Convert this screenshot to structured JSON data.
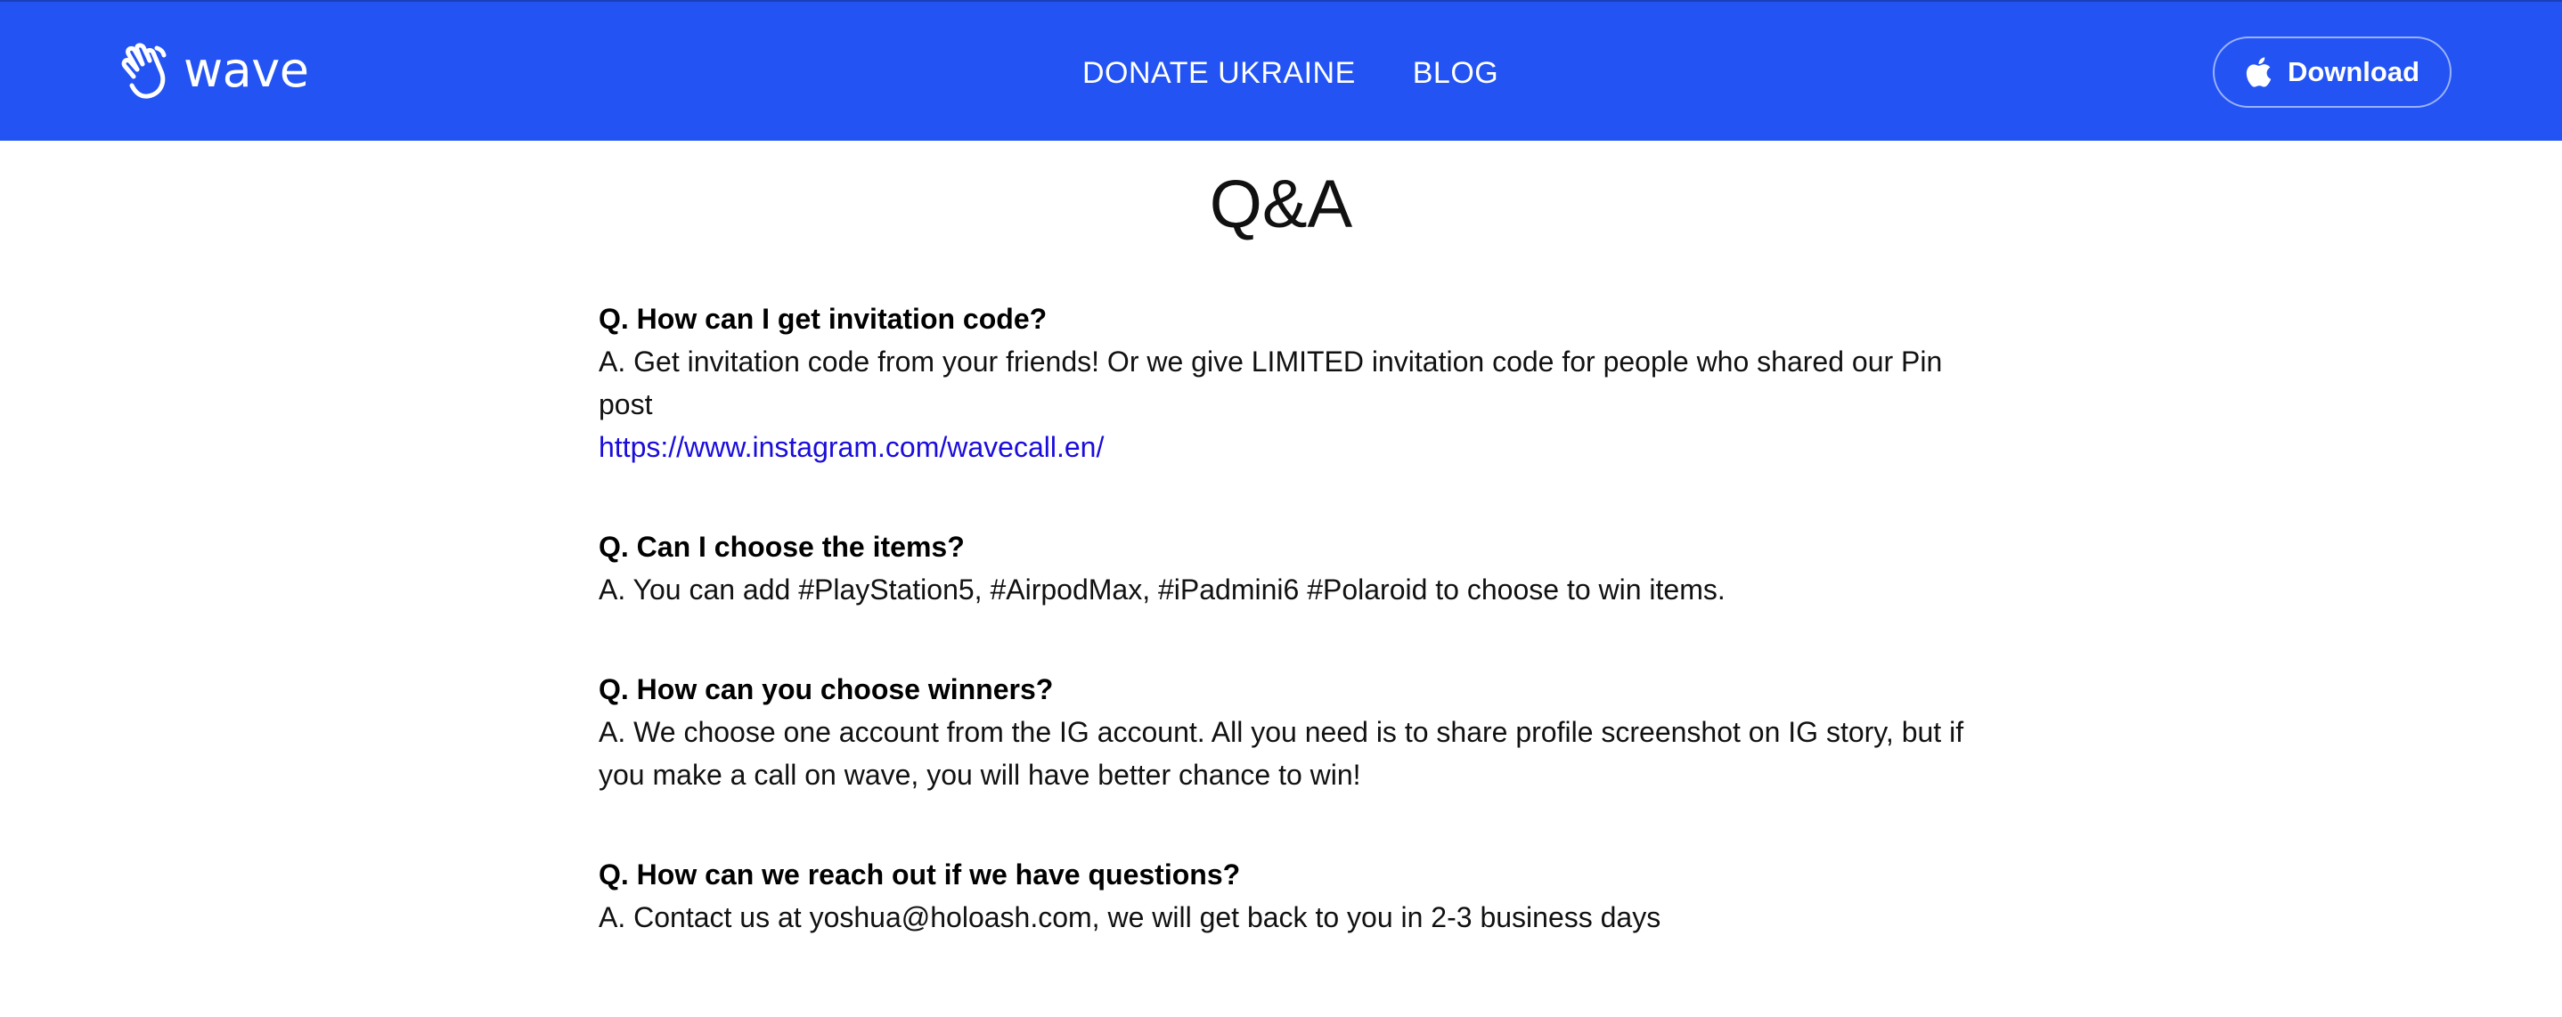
{
  "header": {
    "brand_name": "wave",
    "brand_icon": "waving-hand-icon",
    "nav_links": [
      "DONATE UKRAINE",
      "BLOG"
    ],
    "download_label": "Download",
    "download_icon": "apple-icon",
    "background_color": "#2354f3"
  },
  "main": {
    "title": "Q&A",
    "faq": [
      {
        "question": "Q. How can I get invitation code?",
        "answer": "A. Get invitation code from your friends! Or we give LIMITED invitation code for people who shared our Pin post",
        "link": "https://www.instagram.com/wavecall.en/"
      },
      {
        "question": "Q. Can I choose the items?",
        "answer": "A. You can add #PlayStation5, #AirpodMax, #iPadmini6 #Polaroid to choose to win items."
      },
      {
        "question": "Q. How can you choose winners?",
        "answer": "A. We choose one account from the IG account. All you need is to share profile screenshot on IG story, but if you make a call on wave, you will have better chance to win!"
      },
      {
        "question": "Q. How can we reach out if we have questions?",
        "answer": "A. Contact us at yoshua@holoash.com, we will get back to you in 2-3 business days"
      }
    ],
    "link_color": "#1a0ddb"
  }
}
